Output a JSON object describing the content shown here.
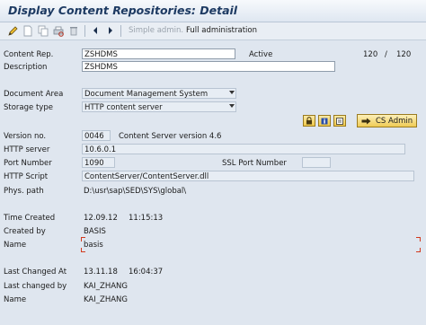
{
  "window": {
    "title": "Display Content Repositories: Detail"
  },
  "toolbar": {
    "icons": [
      "pencil-icon",
      "new-document-icon",
      "copy-icon",
      "print-preview-icon",
      "delete-icon",
      "previous-icon",
      "next-icon"
    ],
    "simple_admin": "Simple admin.",
    "full_admin": "Full administration"
  },
  "form": {
    "content_rep": {
      "label": "Content Rep.",
      "value": "ZSHDMS",
      "status": "Active",
      "counter": "120",
      "counter_sep": "/",
      "counter_total": "120"
    },
    "description": {
      "label": "Description",
      "value": "ZSHDMS"
    },
    "document_area": {
      "label": "Document Area",
      "value": "Document Management System"
    },
    "storage_type": {
      "label": "Storage type",
      "value": "HTTP content server"
    },
    "icon_buttons": [
      "lock-icon",
      "info-icon",
      "display-icon"
    ],
    "cs_admin": "CS Admin",
    "version_no": {
      "label": "Version no.",
      "value": "0046",
      "text": "Content Server version 4.6"
    },
    "http_server": {
      "label": "HTTP server",
      "value": "10.6.0.1"
    },
    "port_number": {
      "label": "Port Number",
      "value": "1090"
    },
    "ssl_port": {
      "label": "SSL Port Number",
      "value": ""
    },
    "http_script": {
      "label": "HTTP Script",
      "value": "ContentServer/ContentServer.dll"
    },
    "phys_path": {
      "label": "Phys. path",
      "value": "D:\\usr\\sap\\SED\\SYS\\global\\"
    },
    "time_created": {
      "label": "Time Created",
      "date": "12.09.12",
      "time": "11:15:13"
    },
    "created_by": {
      "label": "Created by",
      "value": "BASIS"
    },
    "name1": {
      "label": "Name",
      "value": "basis"
    },
    "last_changed_at": {
      "label": "Last Changed At",
      "date": "13.11.18",
      "time": "16:04:37"
    },
    "last_changed_by": {
      "label": "Last changed by",
      "value": "KAI_ZHANG"
    },
    "name2": {
      "label": "Name",
      "value": "KAI_ZHANG"
    }
  },
  "colors": {
    "background": "#dfe6ef",
    "title_text": "#1d3a62",
    "button_gold": "#f0c84a",
    "required_marker": "#d23a1e"
  }
}
